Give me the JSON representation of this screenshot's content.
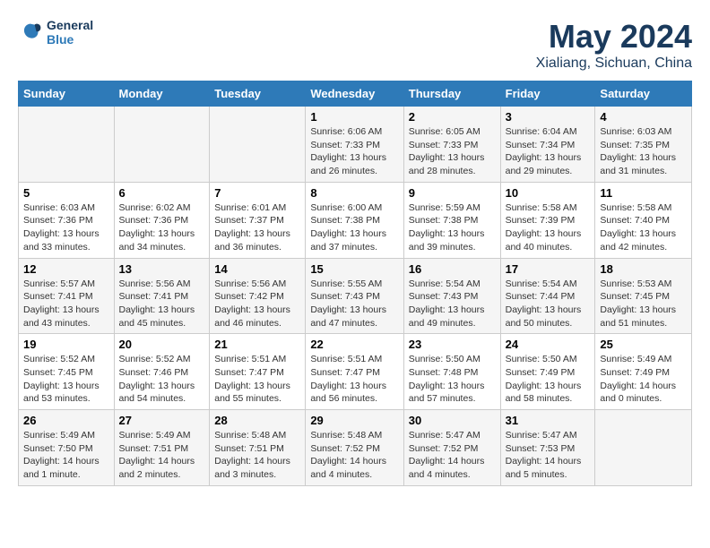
{
  "header": {
    "logo_line1": "General",
    "logo_line2": "Blue",
    "month": "May 2024",
    "location": "Xialiang, Sichuan, China"
  },
  "weekdays": [
    "Sunday",
    "Monday",
    "Tuesday",
    "Wednesday",
    "Thursday",
    "Friday",
    "Saturday"
  ],
  "weeks": [
    [
      {
        "day": "",
        "info": ""
      },
      {
        "day": "",
        "info": ""
      },
      {
        "day": "",
        "info": ""
      },
      {
        "day": "1",
        "info": "Sunrise: 6:06 AM\nSunset: 7:33 PM\nDaylight: 13 hours\nand 26 minutes."
      },
      {
        "day": "2",
        "info": "Sunrise: 6:05 AM\nSunset: 7:33 PM\nDaylight: 13 hours\nand 28 minutes."
      },
      {
        "day": "3",
        "info": "Sunrise: 6:04 AM\nSunset: 7:34 PM\nDaylight: 13 hours\nand 29 minutes."
      },
      {
        "day": "4",
        "info": "Sunrise: 6:03 AM\nSunset: 7:35 PM\nDaylight: 13 hours\nand 31 minutes."
      }
    ],
    [
      {
        "day": "5",
        "info": "Sunrise: 6:03 AM\nSunset: 7:36 PM\nDaylight: 13 hours\nand 33 minutes."
      },
      {
        "day": "6",
        "info": "Sunrise: 6:02 AM\nSunset: 7:36 PM\nDaylight: 13 hours\nand 34 minutes."
      },
      {
        "day": "7",
        "info": "Sunrise: 6:01 AM\nSunset: 7:37 PM\nDaylight: 13 hours\nand 36 minutes."
      },
      {
        "day": "8",
        "info": "Sunrise: 6:00 AM\nSunset: 7:38 PM\nDaylight: 13 hours\nand 37 minutes."
      },
      {
        "day": "9",
        "info": "Sunrise: 5:59 AM\nSunset: 7:38 PM\nDaylight: 13 hours\nand 39 minutes."
      },
      {
        "day": "10",
        "info": "Sunrise: 5:58 AM\nSunset: 7:39 PM\nDaylight: 13 hours\nand 40 minutes."
      },
      {
        "day": "11",
        "info": "Sunrise: 5:58 AM\nSunset: 7:40 PM\nDaylight: 13 hours\nand 42 minutes."
      }
    ],
    [
      {
        "day": "12",
        "info": "Sunrise: 5:57 AM\nSunset: 7:41 PM\nDaylight: 13 hours\nand 43 minutes."
      },
      {
        "day": "13",
        "info": "Sunrise: 5:56 AM\nSunset: 7:41 PM\nDaylight: 13 hours\nand 45 minutes."
      },
      {
        "day": "14",
        "info": "Sunrise: 5:56 AM\nSunset: 7:42 PM\nDaylight: 13 hours\nand 46 minutes."
      },
      {
        "day": "15",
        "info": "Sunrise: 5:55 AM\nSunset: 7:43 PM\nDaylight: 13 hours\nand 47 minutes."
      },
      {
        "day": "16",
        "info": "Sunrise: 5:54 AM\nSunset: 7:43 PM\nDaylight: 13 hours\nand 49 minutes."
      },
      {
        "day": "17",
        "info": "Sunrise: 5:54 AM\nSunset: 7:44 PM\nDaylight: 13 hours\nand 50 minutes."
      },
      {
        "day": "18",
        "info": "Sunrise: 5:53 AM\nSunset: 7:45 PM\nDaylight: 13 hours\nand 51 minutes."
      }
    ],
    [
      {
        "day": "19",
        "info": "Sunrise: 5:52 AM\nSunset: 7:45 PM\nDaylight: 13 hours\nand 53 minutes."
      },
      {
        "day": "20",
        "info": "Sunrise: 5:52 AM\nSunset: 7:46 PM\nDaylight: 13 hours\nand 54 minutes."
      },
      {
        "day": "21",
        "info": "Sunrise: 5:51 AM\nSunset: 7:47 PM\nDaylight: 13 hours\nand 55 minutes."
      },
      {
        "day": "22",
        "info": "Sunrise: 5:51 AM\nSunset: 7:47 PM\nDaylight: 13 hours\nand 56 minutes."
      },
      {
        "day": "23",
        "info": "Sunrise: 5:50 AM\nSunset: 7:48 PM\nDaylight: 13 hours\nand 57 minutes."
      },
      {
        "day": "24",
        "info": "Sunrise: 5:50 AM\nSunset: 7:49 PM\nDaylight: 13 hours\nand 58 minutes."
      },
      {
        "day": "25",
        "info": "Sunrise: 5:49 AM\nSunset: 7:49 PM\nDaylight: 14 hours\nand 0 minutes."
      }
    ],
    [
      {
        "day": "26",
        "info": "Sunrise: 5:49 AM\nSunset: 7:50 PM\nDaylight: 14 hours\nand 1 minute."
      },
      {
        "day": "27",
        "info": "Sunrise: 5:49 AM\nSunset: 7:51 PM\nDaylight: 14 hours\nand 2 minutes."
      },
      {
        "day": "28",
        "info": "Sunrise: 5:48 AM\nSunset: 7:51 PM\nDaylight: 14 hours\nand 3 minutes."
      },
      {
        "day": "29",
        "info": "Sunrise: 5:48 AM\nSunset: 7:52 PM\nDaylight: 14 hours\nand 4 minutes."
      },
      {
        "day": "30",
        "info": "Sunrise: 5:47 AM\nSunset: 7:52 PM\nDaylight: 14 hours\nand 4 minutes."
      },
      {
        "day": "31",
        "info": "Sunrise: 5:47 AM\nSunset: 7:53 PM\nDaylight: 14 hours\nand 5 minutes."
      },
      {
        "day": "",
        "info": ""
      }
    ]
  ]
}
